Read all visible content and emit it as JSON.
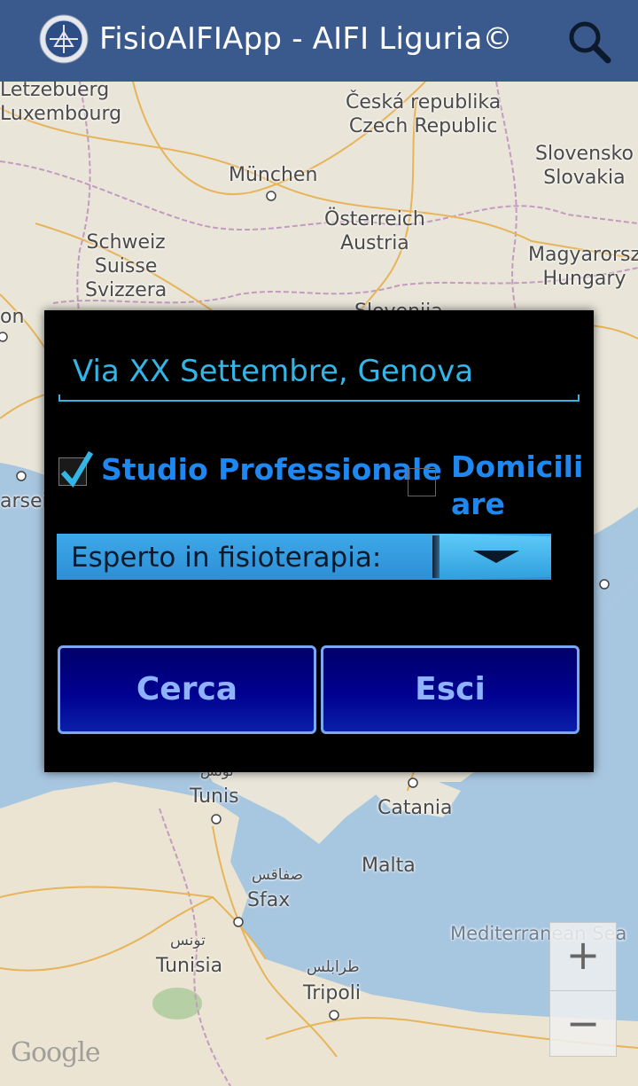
{
  "actionbar": {
    "title": "FisioAIFIApp - AIFI Liguria©",
    "logo_icon": "aifi-logo",
    "search_icon": "search-icon",
    "bg_color": "#3a5a8e"
  },
  "map": {
    "labels": {
      "letzebuerg": "Letzebuerg\nLuxembourg",
      "czech": "Česká republika\nCzech Republic",
      "slovakia": "Slovensko\nSlovakia",
      "munchen": "München",
      "austria": "Österreich\nAustria",
      "swiss": "Schweiz\nSuisse\nSvizzera",
      "hungary": "Magyarorsz\nHungary",
      "lyon": "on",
      "marseille": "arsei",
      "slovenia": "Slovenija",
      "tunis_ar": "تونس",
      "tunis": "Tunis",
      "catania": "Catania",
      "malta": "Malta",
      "sfax_ar": "صفاقس",
      "sfax": "Sfax",
      "tunisia_ar": "تونس",
      "tunisia": "Tunisia",
      "tripoli_ar": "طرابلس",
      "tripoli": "Tripoli",
      "med_sea": "Mediterranean Sea"
    },
    "zoom_in": "+",
    "zoom_out": "−",
    "attribution": "Google"
  },
  "dialog": {
    "address_value": "Via XX Settembre, Genova",
    "studio_label": "Studio Professionale",
    "studio_checked": true,
    "domic_label": "Domiciliare",
    "domic_checked": false,
    "spinner_label": "Esperto in fisioterapia:",
    "search_button": "Cerca",
    "exit_button": "Esci",
    "accent_color": "#33b5e5"
  }
}
